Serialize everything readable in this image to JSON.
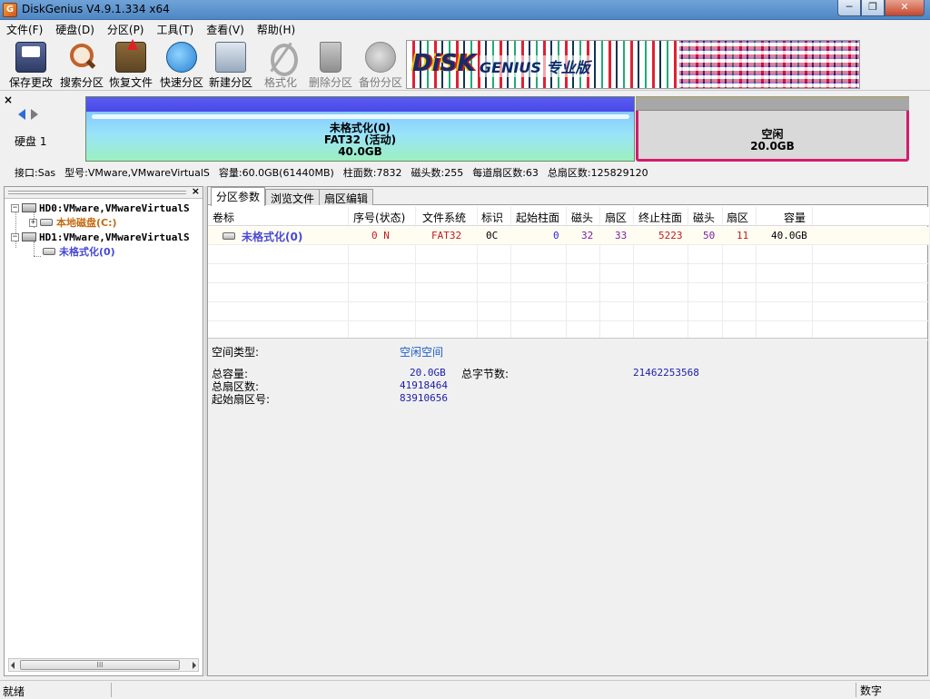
{
  "window": {
    "app_icon": "G",
    "title": "DiskGenius V4.9.1.334 x64",
    "buttons": {
      "minimize": "─",
      "maximize": "❐",
      "close": "✕"
    }
  },
  "menu": [
    "文件(F)",
    "硬盘(D)",
    "分区(P)",
    "工具(T)",
    "查看(V)",
    "帮助(H)"
  ],
  "toolbar": [
    {
      "label": "保存更改",
      "icon": "save-icon",
      "enabled": true
    },
    {
      "label": "搜索分区",
      "icon": "search-icon",
      "enabled": true
    },
    {
      "label": "恢复文件",
      "icon": "recover-icon",
      "enabled": true
    },
    {
      "label": "快速分区",
      "icon": "quick-partition-icon",
      "enabled": true
    },
    {
      "label": "新建分区",
      "icon": "new-partition-icon",
      "enabled": true
    },
    {
      "label": "格式化",
      "icon": "format-icon",
      "enabled": false
    },
    {
      "label": "删除分区",
      "icon": "delete-icon",
      "enabled": false
    },
    {
      "label": "备份分区",
      "icon": "backup-icon",
      "enabled": false
    }
  ],
  "banner": {
    "logo": "DiSK",
    "word": "GENIUS 专业版"
  },
  "diskmap": {
    "close": "×",
    "disk_label": "硬盘 1",
    "partition": {
      "name": "未格式化(0)",
      "fs": "FAT32 (活动)",
      "size": "40.0GB"
    },
    "free": {
      "name": "空闲",
      "size": "20.0GB"
    },
    "info": [
      "接口:Sas",
      "型号:VMware,VMwareVirtualS",
      "容量:60.0GB(61440MB)",
      "柱面数:7832",
      "磁头数:255",
      "每道扇区数:63",
      "总扇区数:125829120"
    ]
  },
  "tree": {
    "close": "×",
    "nodes": [
      {
        "text": "HD0:VMware,VMwareVirtualS",
        "expander": "−"
      },
      {
        "text": "本地磁盘(C:)",
        "expander": "+"
      },
      {
        "text": "HD1:VMware,VMwareVirtualS",
        "expander": "−"
      },
      {
        "text": "未格式化(0)",
        "expander": ""
      }
    ],
    "scroll_thumb": "III"
  },
  "tabs": [
    "分区参数",
    "浏览文件",
    "扇区编辑"
  ],
  "table": {
    "headers": [
      "卷标",
      "序号(状态)",
      "文件系统",
      "标识",
      "起始柱面",
      "磁头",
      "扇区",
      "终止柱面",
      "磁头",
      "扇区",
      "容量"
    ],
    "rows": [
      [
        "未格式化(0)",
        "0 N",
        "FAT32",
        "0C",
        "0",
        "32",
        "33",
        "5223",
        "50",
        "11",
        "40.0GB"
      ]
    ]
  },
  "details": {
    "type_label": "空间类型:",
    "type_value": "空闲空间",
    "total_cap_label": "总容量:",
    "total_cap_value": "20.0GB",
    "total_bytes_label": "总字节数:",
    "total_bytes_value": "21462253568",
    "total_sectors_label": "总扇区数:",
    "total_sectors_value": "41918464",
    "start_sector_label": "起始扇区号:",
    "start_sector_value": "83910656"
  },
  "status": {
    "left": "就绪",
    "right": "数字"
  },
  "colors": {
    "partition_active_border": "#d51a6e",
    "partition_top": "#4a49e8",
    "name_blue": "#4848d8",
    "local_disk": "#c56a12"
  }
}
